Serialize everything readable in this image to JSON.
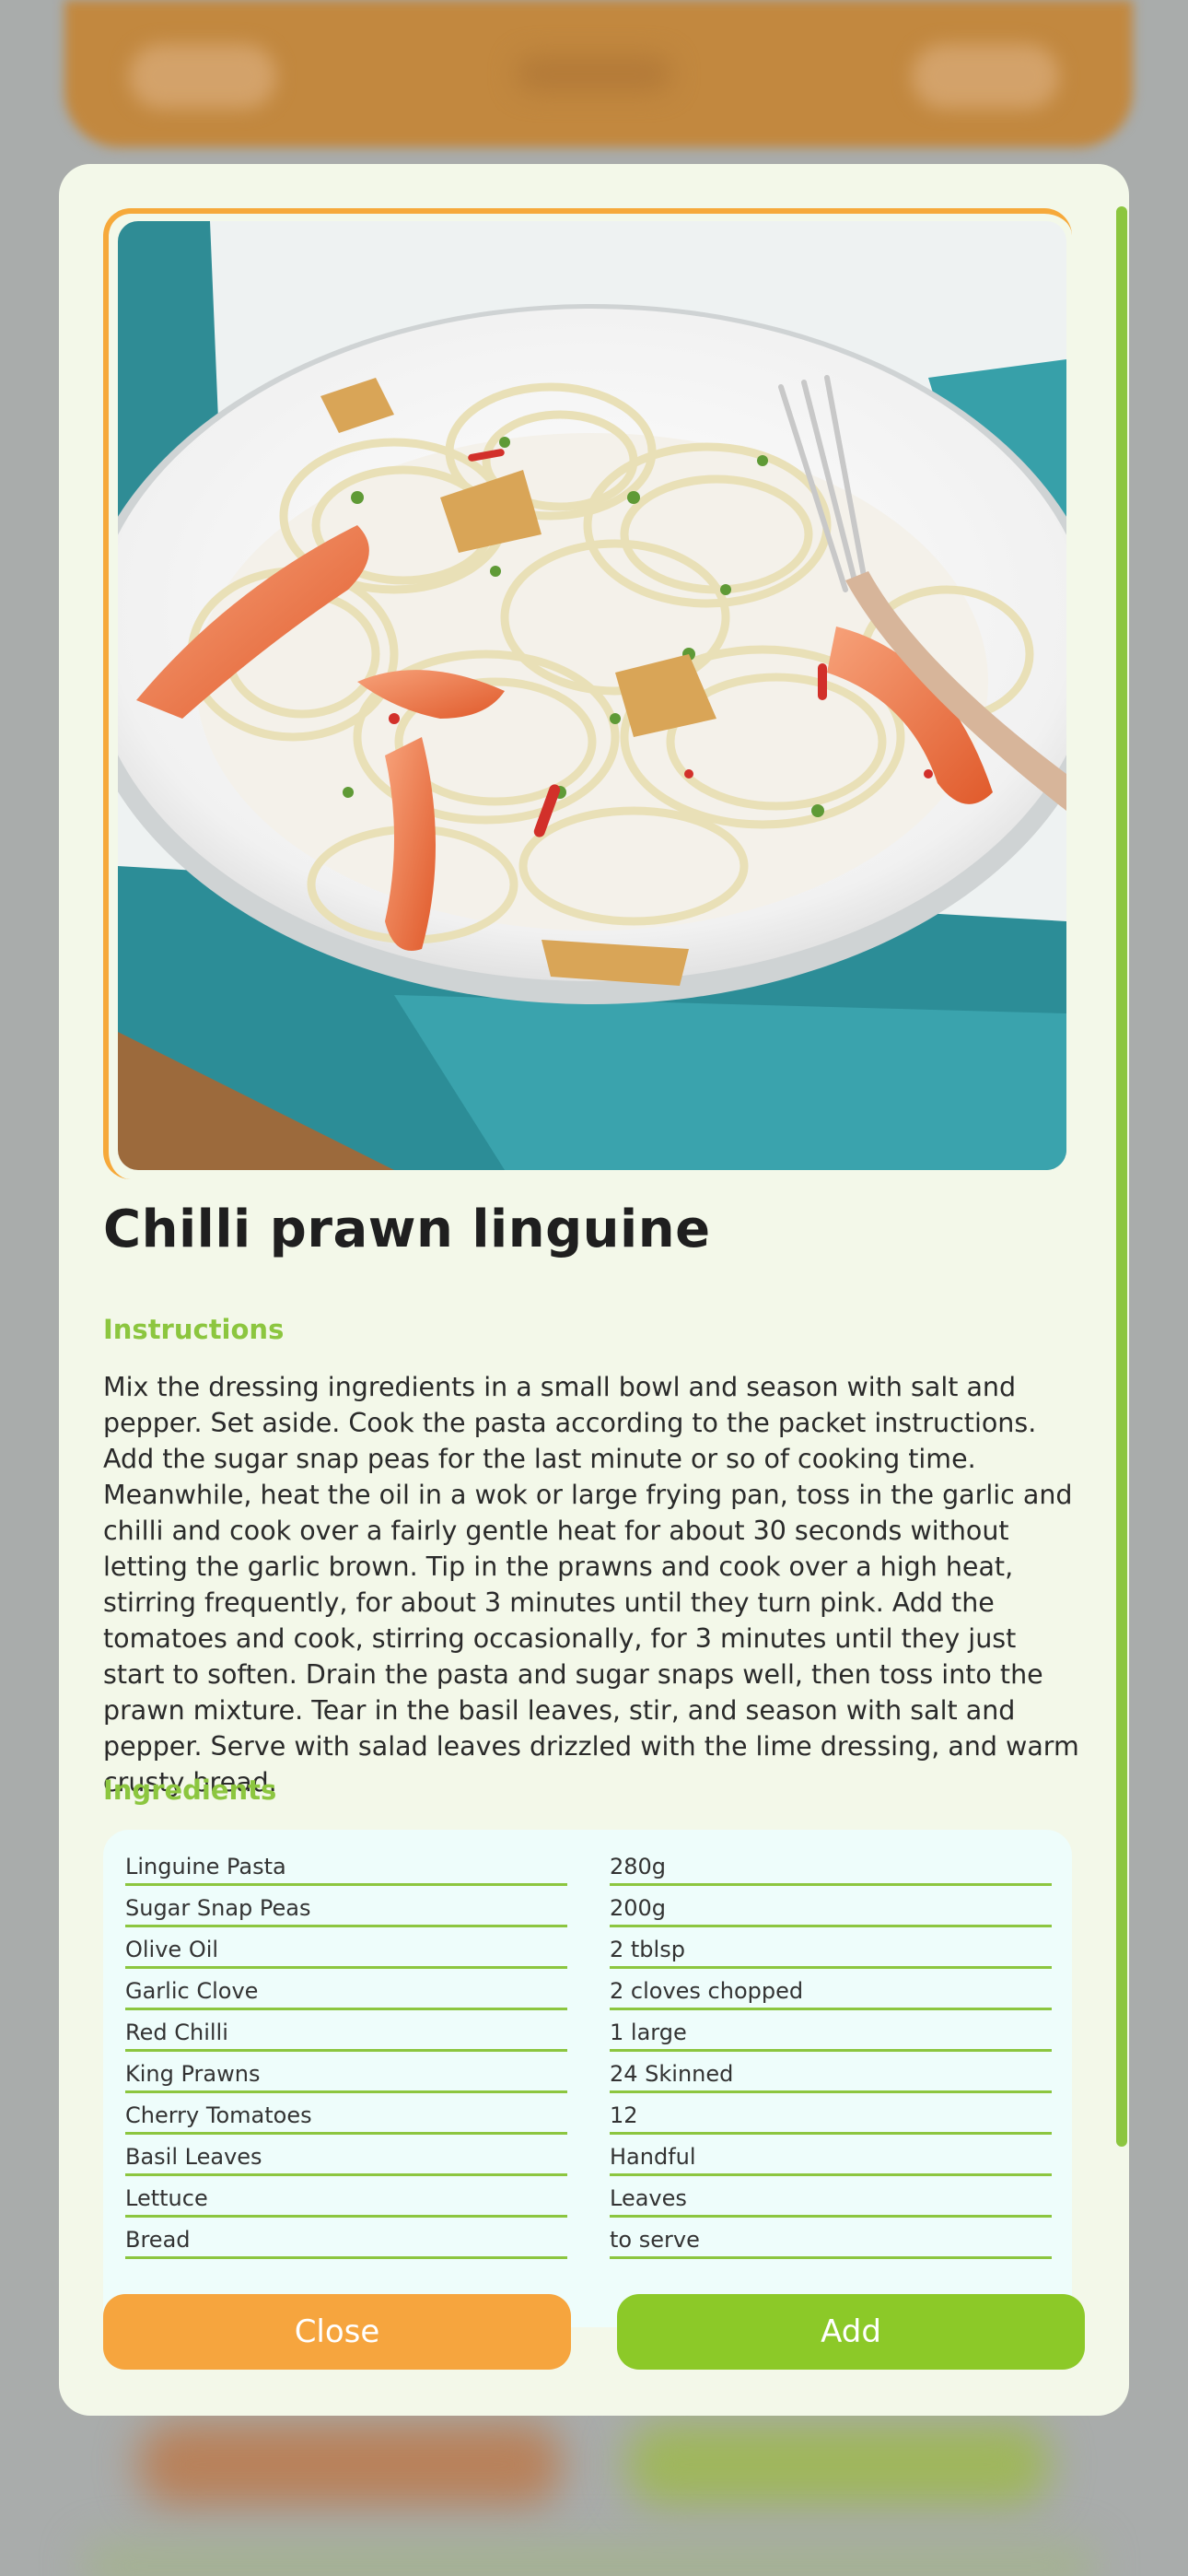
{
  "recipe": {
    "title": "Chilli prawn linguine",
    "instructions_label": "Instructions",
    "instructions": "Mix the dressing ingredients in a small bowl and season with salt and pepper. Set aside. Cook the pasta according to the packet instructions. Add the sugar snap peas for the last minute or so of cooking time. Meanwhile, heat the oil in a wok or large frying pan, toss in the garlic and chilli and cook over a fairly gentle heat for about 30 seconds without letting the garlic brown. Tip in the prawns and cook over a high heat, stirring frequently, for about 3 minutes until they turn pink. Add the tomatoes and cook, stirring occasionally, for 3 minutes until they just start to soften. Drain the pasta and sugar snaps well, then toss into the prawn mixture. Tear in the basil leaves, stir, and season with salt and pepper. Serve with salad leaves drizzled with the lime dressing, and warm crusty bread.",
    "ingredients_label": "Ingredients",
    "ingredients": [
      {
        "name": "Linguine Pasta",
        "amount": "280g"
      },
      {
        "name": "Sugar Snap Peas",
        "amount": "200g"
      },
      {
        "name": "Olive Oil",
        "amount": "2 tblsp"
      },
      {
        "name": "Garlic Clove",
        "amount": "2 cloves chopped"
      },
      {
        "name": "Red Chilli",
        "amount": "1 large"
      },
      {
        "name": "King Prawns",
        "amount": "24 Skinned"
      },
      {
        "name": "Cherry Tomatoes",
        "amount": "12"
      },
      {
        "name": "Basil Leaves",
        "amount": "Handful"
      },
      {
        "name": "Lettuce",
        "amount": "Leaves"
      },
      {
        "name": "Bread",
        "amount": "to serve"
      }
    ]
  },
  "actions": {
    "close_label": "Close",
    "add_label": "Add"
  },
  "colors": {
    "accent_green": "#8cc63f",
    "accent_orange": "#f6a53e",
    "modal_bg": "#f3f8e9",
    "ingredients_bg": "#eefdfb"
  },
  "icons": {
    "photo": "pasta-dish-image"
  }
}
